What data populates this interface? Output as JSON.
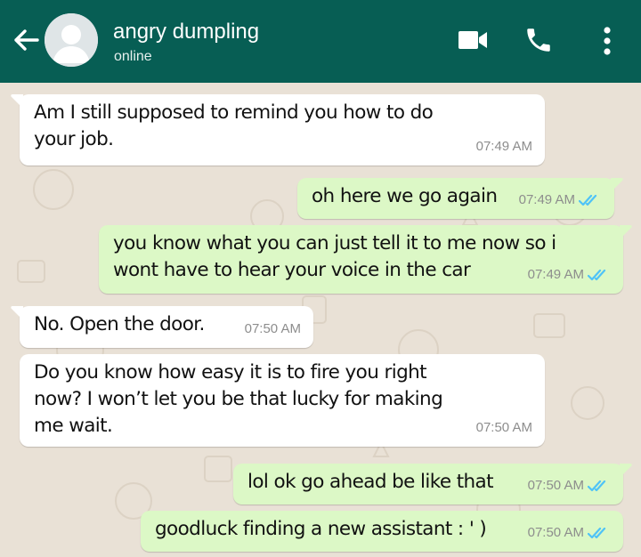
{
  "header": {
    "contact_name": "angry dumpling",
    "status": "online",
    "icons": [
      "back-arrow-icon",
      "avatar",
      "video-call-icon",
      "phone-icon",
      "more-options-icon"
    ]
  },
  "colors": {
    "header_bg": "#075e54",
    "chat_bg": "#e9e1d6",
    "incoming_bubble": "#ffffff",
    "outgoing_bubble": "#dcf8c6",
    "read_ticks": "#4fc3f7"
  },
  "messages": [
    {
      "direction": "incoming",
      "lines": [
        "Am I still supposed to remind you how to do",
        "your job."
      ],
      "time": "07:49 AM"
    },
    {
      "direction": "outgoing",
      "lines": [
        "oh here we go again"
      ],
      "time": "07:49 AM",
      "read": true
    },
    {
      "direction": "outgoing",
      "lines": [
        "you know what you can just tell it to me now so i",
        "wont have to hear your voice in the car"
      ],
      "time": "07:49 AM",
      "read": true
    },
    {
      "direction": "incoming",
      "lines": [
        "No. Open the door."
      ],
      "time": "07:50 AM"
    },
    {
      "direction": "incoming",
      "lines": [
        "Do you know how easy it is to fire you right",
        "now? I won’t let you be that lucky for making",
        "me wait."
      ],
      "time": "07:50 AM"
    },
    {
      "direction": "outgoing",
      "lines": [
        "lol ok go ahead be like that"
      ],
      "time": "07:50 AM",
      "read": true
    },
    {
      "direction": "outgoing",
      "lines": [
        "goodluck finding a new assistant : ' )"
      ],
      "time": "07:50 AM",
      "read": true
    }
  ]
}
